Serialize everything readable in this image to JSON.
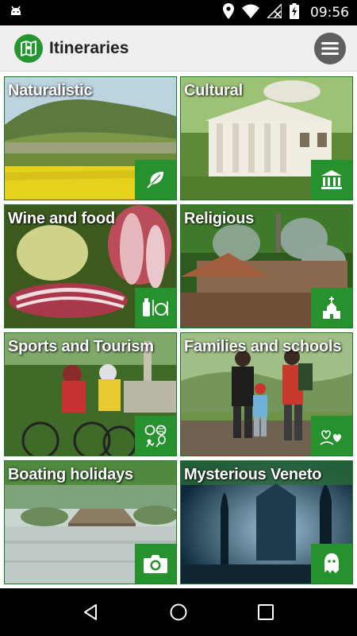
{
  "status_bar": {
    "time": "09:56",
    "icons": [
      "android-debug-icon",
      "location-icon",
      "wifi-icon",
      "no-signal-icon",
      "battery-charging-icon"
    ]
  },
  "app_bar": {
    "title": "Itineraries",
    "logo_icon": "map-icon",
    "menu_icon": "hamburger-icon"
  },
  "tiles": [
    {
      "label": "Naturalistic",
      "icon": "leaf-icon"
    },
    {
      "label": "Cultural",
      "icon": "museum-icon"
    },
    {
      "label": "Wine and food",
      "icon": "wine-dining-icon"
    },
    {
      "label": "Religious",
      "icon": "church-icon"
    },
    {
      "label": "Sports and Tourism",
      "icon": "sports-icon"
    },
    {
      "label": "Families and schools",
      "icon": "family-icon"
    },
    {
      "label": "Boating holidays",
      "icon": "camera-icon"
    },
    {
      "label": "Mysterious Veneto",
      "icon": "ghost-icon"
    }
  ],
  "nav_bar": {
    "icons": [
      "back-icon",
      "home-icon",
      "recents-icon"
    ]
  },
  "colors": {
    "accent_green": "#25922d",
    "app_bar_bg": "#efefef",
    "menu_button": "#5f5f5f"
  }
}
